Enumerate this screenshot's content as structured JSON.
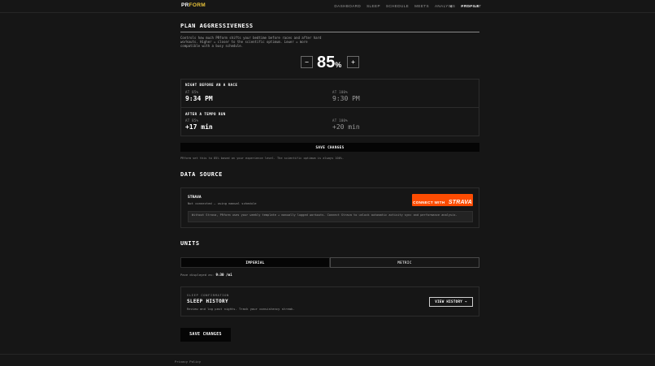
{
  "brand": {
    "pr": "PR",
    "form": "FORM",
    "accent": "#e8c33a"
  },
  "nav": {
    "items": [
      "DASHBOARD",
      "SLEEP",
      "SCHEDULE",
      "MEETS",
      "ANALYSIS",
      "PROFILE"
    ],
    "active": "PROFILE",
    "theme_icon": "half-moon-icon",
    "signout": "SIGN OUT"
  },
  "aggressiveness": {
    "title": "PLAN AGGRESSIVENESS",
    "description": "Controls how much PRform shifts your bedtime before races and after hard workouts. Higher = closer to the scientific optimum. Lower = more compatible with a busy schedule.",
    "decrement": "−",
    "value": "85",
    "unit": "%",
    "increment": "+",
    "examples": [
      {
        "heading": "NIGHT BEFORE AN A RACE",
        "at_label": "AT 85%",
        "at_value": "9:34 PM",
        "full_label": "AT 100%",
        "full_value": "9:30 PM"
      },
      {
        "heading": "AFTER A TEMPO RUN",
        "at_label": "AT 85%",
        "at_value": "+17 min",
        "full_label": "AT 100%",
        "full_value": "+20 min"
      }
    ],
    "save_label": "SAVE CHANGES",
    "note": "PRform set this to 85% based on your experience level. The scientific optimum is always 100%."
  },
  "data_source": {
    "title": "DATA SOURCE",
    "name": "STRAVA",
    "status": "Not connected — using manual schedule",
    "connect_prefix": "CONNECT WITH",
    "connect_brand": "STRAVA",
    "connect_color": "#fc4c02",
    "info": "Without Strava, PRform uses your weekly template + manually logged workouts. Connect Strava to unlock automatic activity sync and performance analysis."
  },
  "units": {
    "title": "UNITS",
    "options": [
      "IMPERIAL",
      "METRIC"
    ],
    "selected": "IMPERIAL",
    "pace_prefix": "Pace displayed as:",
    "pace_value": "9:30 /mi"
  },
  "sleep_history": {
    "eyebrow": "SLEEP CONFIRMATION",
    "title": "SLEEP HISTORY",
    "description": "Review and log past nights. Track your consistency streak.",
    "button": "VIEW HISTORY →"
  },
  "footer": {
    "save_label": "SAVE CHANGES",
    "privacy": "Privacy Policy"
  }
}
